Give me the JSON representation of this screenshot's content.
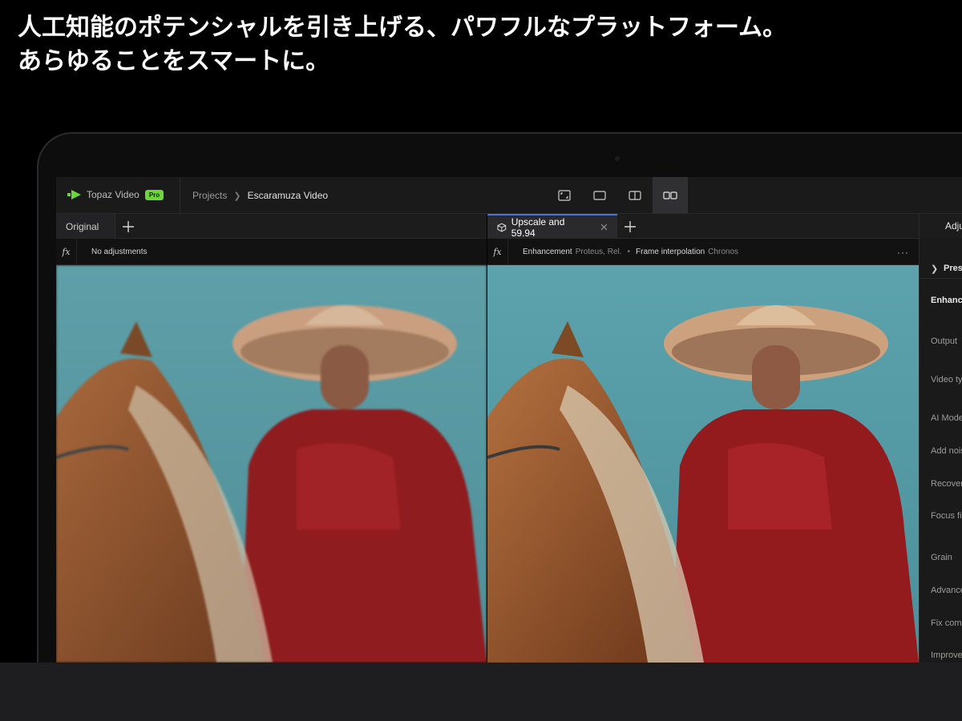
{
  "headline": {
    "line1": "人工知能のポテンシャルを引き上げる、パワフルなプラットフォーム。",
    "line2": "あらゆることをスマートに。"
  },
  "app": {
    "name": "Topaz Video",
    "badge": "Pro",
    "accent": "#6dd63c",
    "tab_accent": "#4a74d8"
  },
  "breadcrumb": {
    "parent": "Projects",
    "current": "Escaramuza Video"
  },
  "view_modes": [
    "fullscreen-icon",
    "single-view-icon",
    "split-view-icon",
    "side-by-side-icon"
  ],
  "left_panel": {
    "tab_label": "Original",
    "fx_text": "No adjustments"
  },
  "right_panel": {
    "tab_label": "Upscale and 59.94",
    "fx_items": [
      {
        "key": "Enhancement",
        "value": "Proteus, Rel."
      },
      {
        "key": "Frame interpolation",
        "value": "Chronos"
      }
    ],
    "more": "···"
  },
  "side_panel": {
    "header": "Adjustments",
    "presets": "Presets",
    "enhancement": "Enhancement",
    "rows": [
      "Output",
      "Video type",
      "AI Model",
      "Add noise",
      "Recover",
      "Focus fix",
      "Grain",
      "Advanced",
      "Fix compression",
      "Improve"
    ]
  }
}
